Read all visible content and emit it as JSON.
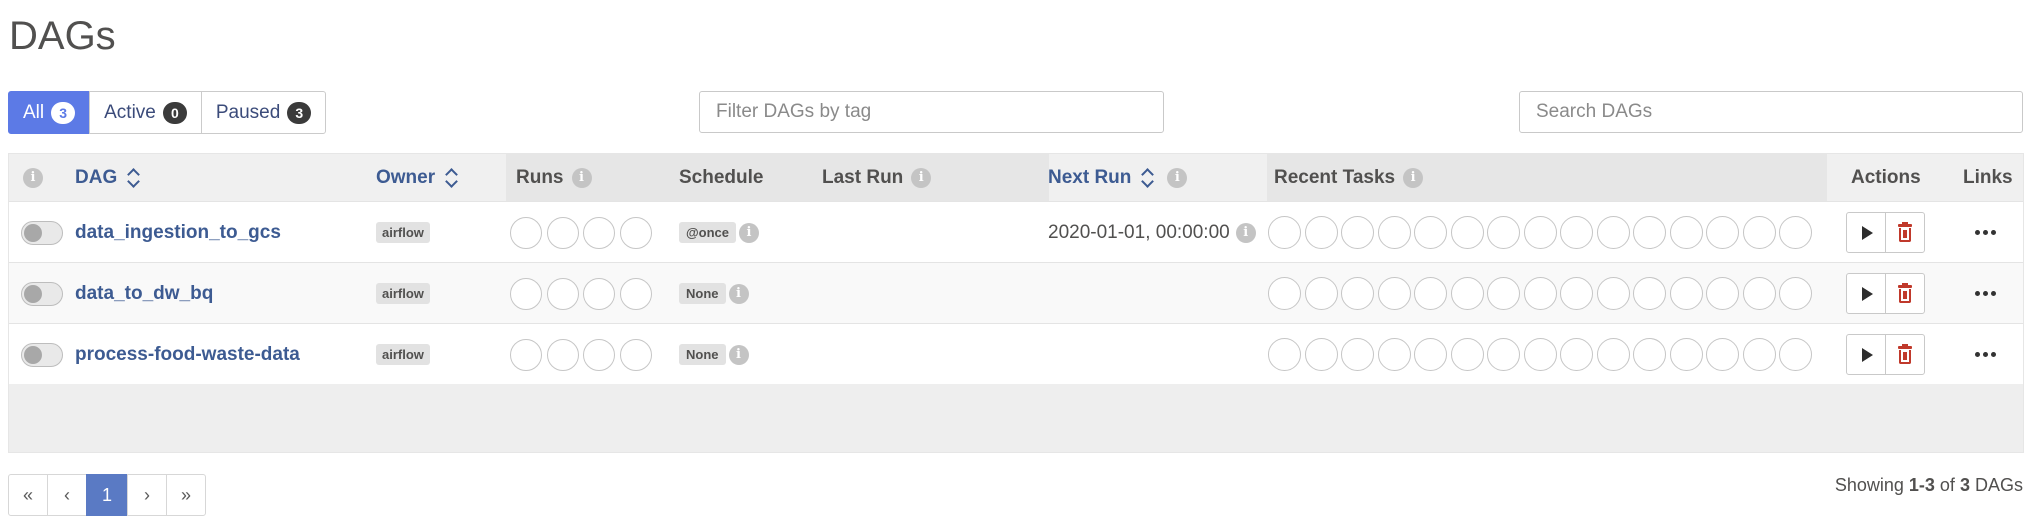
{
  "page": {
    "title": "DAGs"
  },
  "filters": {
    "all": {
      "label": "All",
      "count": "3"
    },
    "active": {
      "label": "Active",
      "count": "0"
    },
    "paused": {
      "label": "Paused",
      "count": "3"
    }
  },
  "tag_filter": {
    "placeholder": "Filter DAGs by tag",
    "value": ""
  },
  "search": {
    "placeholder": "Search DAGs",
    "value": ""
  },
  "table": {
    "headers": {
      "info": "i",
      "dag": "DAG",
      "owner": "Owner",
      "runs": "Runs",
      "schedule": "Schedule",
      "last_run": "Last Run",
      "next_run": "Next Run",
      "recent_tasks": "Recent Tasks",
      "actions": "Actions",
      "links": "Links"
    },
    "rows": [
      {
        "dag_id": "data_ingestion_to_gcs",
        "owner": "airflow",
        "schedule": "@once",
        "last_run": "",
        "next_run": "2020-01-01, 00:00:00",
        "paused": true
      },
      {
        "dag_id": "data_to_dw_bq",
        "owner": "airflow",
        "schedule": "None",
        "last_run": "",
        "next_run": "",
        "paused": true
      },
      {
        "dag_id": "process-food-waste-data",
        "owner": "airflow",
        "schedule": "None",
        "last_run": "",
        "next_run": "",
        "paused": true
      }
    ]
  },
  "pagination": {
    "first": "«",
    "prev": "‹",
    "current": "1",
    "next": "›",
    "last": "»"
  },
  "footer": {
    "showing_prefix": "Showing",
    "range": "1-3",
    "of": "of",
    "total": "3",
    "suffix": "DAGs"
  },
  "colors": {
    "accent": "#5c7ae6",
    "link": "#3d5b92",
    "trash": "#c0392b"
  }
}
